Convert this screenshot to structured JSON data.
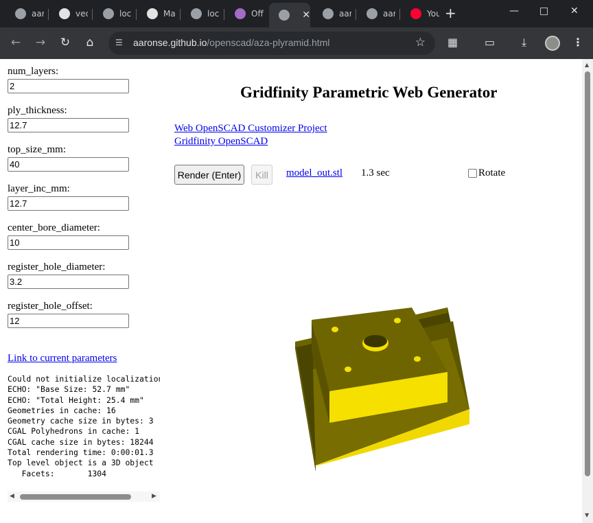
{
  "browser": {
    "tabs": [
      {
        "label": "aar",
        "color": "#9aa0a6"
      },
      {
        "label": "vec",
        "color": "#e3e3e3"
      },
      {
        "label": "loc",
        "color": "#9aa0a6"
      },
      {
        "label": "Ma",
        "color": "#e3e3e3"
      },
      {
        "label": "loc",
        "color": "#9aa0a6"
      },
      {
        "label": "Off",
        "color": "#a46bc9"
      },
      {
        "label": "",
        "color": "#9aa0a6",
        "active": true
      },
      {
        "label": "aar",
        "color": "#9aa0a6"
      },
      {
        "label": "aar",
        "color": "#9aa0a6"
      },
      {
        "label": "You",
        "color": "#ff0033"
      }
    ],
    "url_host": "aaronse.github.io",
    "url_path": "/openscad/aza-plyramid.html",
    "accent": "#35363a"
  },
  "params": [
    {
      "label": "num_layers:",
      "value": "2"
    },
    {
      "label": "ply_thickness:",
      "value": "12.7"
    },
    {
      "label": "top_size_mm:",
      "value": "40"
    },
    {
      "label": "layer_inc_mm:",
      "value": "12.7"
    },
    {
      "label": "center_bore_diameter:",
      "value": "10"
    },
    {
      "label": "register_hole_diameter:",
      "value": "3.2"
    },
    {
      "label": "register_hole_offset:",
      "value": "12"
    }
  ],
  "link_params": "Link to current parameters",
  "console_lines": [
    "Could not initialize localization",
    "ECHO: \"Base Size: 52.7 mm\"",
    "ECHO: \"Total Height: 25.4 mm\"",
    "Geometries in cache: 16",
    "Geometry cache size in bytes: 3",
    "CGAL Polyhedrons in cache: 1",
    "CGAL cache size in bytes: 18244",
    "Total rendering time: 0:00:01.3",
    "Top level object is a 3D object",
    "   Facets:       1304"
  ],
  "title": "Gridfinity Parametric Web Generator",
  "links": [
    "Web OpenSCAD Customizer Project",
    "Gridfinity OpenSCAD"
  ],
  "render_button": "Render (Enter)",
  "kill_button": "Kill",
  "model_link": "model_out.stl",
  "render_time": "1.3 sec",
  "rotate_label": "Rotate",
  "model_color": "#f5e000"
}
